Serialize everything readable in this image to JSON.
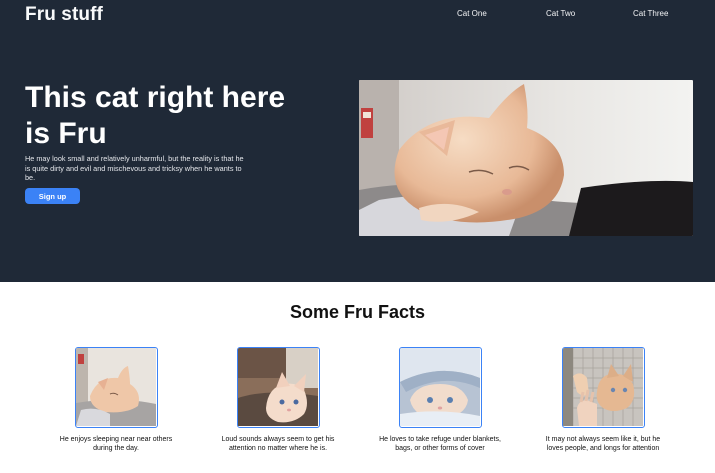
{
  "header": {
    "logo": "Fru stuff",
    "nav": [
      {
        "label": "Cat One"
      },
      {
        "label": "Cat Two"
      },
      {
        "label": "Cat Three"
      }
    ]
  },
  "hero": {
    "headline": "This cat right here is Fru",
    "description": "He may look small and relatively unharmful, but the reality is that he is quite dirty and evil and mischevous and tricksy when he wants to be.",
    "cta_label": "Sign up",
    "image_icon": "cat-photo"
  },
  "facts": {
    "title": "Some Fru Facts",
    "items": [
      {
        "caption": "He enjoys sleeping near near others during the day.",
        "image_icon": "cat-sleeping-photo"
      },
      {
        "caption": "Loud sounds always seem to get his attention no matter where he is.",
        "image_icon": "cat-alert-photo"
      },
      {
        "caption": "He loves to take refuge under blankets, bags, or other forms of cover",
        "image_icon": "cat-blanket-photo"
      },
      {
        "caption": "It may not always seem like it, but he loves people, and longs for attention",
        "image_icon": "cat-hand-photo"
      }
    ]
  },
  "colors": {
    "hero_bg": "#1f2937",
    "accent": "#3b82f6",
    "page_bg": "#ffffff"
  }
}
